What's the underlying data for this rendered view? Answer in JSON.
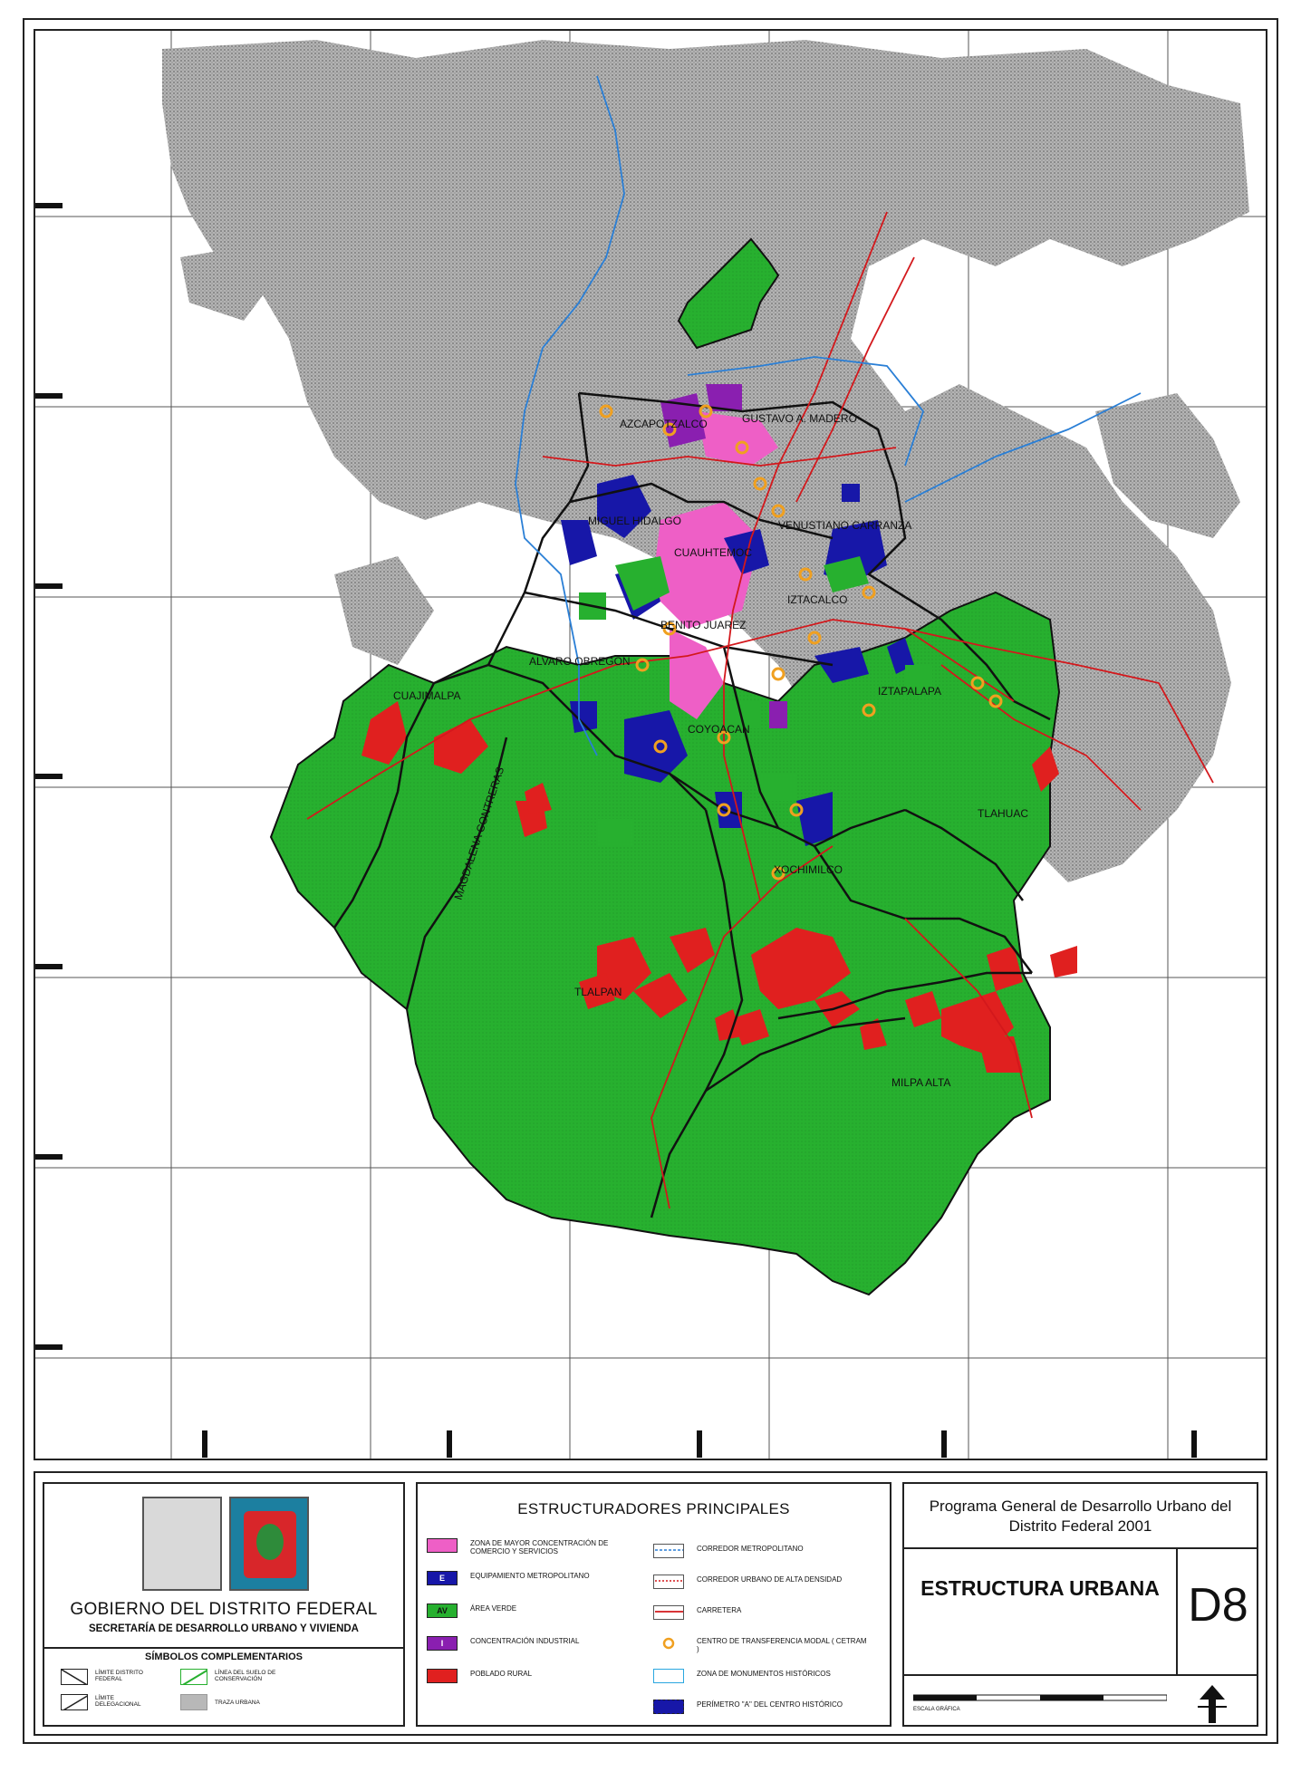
{
  "map": {
    "delegaciones": [
      "AZCAPOTZALCO",
      "GUSTAVO A. MADERO",
      "MIGUEL HIDALGO",
      "CUAUHTEMOC",
      "VENUSTIANO CARRANZA",
      "IZTACALCO",
      "BENITO JUAREZ",
      "ALVARO OBREGON",
      "CUAJIMALPA",
      "IZTAPALAPA",
      "COYOACAN",
      "MAGDALENA CONTRERAS",
      "TLAHUAC",
      "XOCHIMILCO",
      "TLALPAN",
      "MILPA ALTA"
    ],
    "swatch_code": "AV",
    "colors": {
      "conservation_green": "#27b02f",
      "urban_gray": "#9e9e9e",
      "rural_red": "#e0201f",
      "commerce_pink": "#ee5fc6",
      "equipment_blue": "#1717a8",
      "industrial_purple": "#8a1fb0",
      "road_red": "#d3181c",
      "metro_blue": "#2a7fd6",
      "cetram_orange": "#f0a020"
    }
  },
  "government": {
    "title": "GOBIERNO DEL DISTRITO FEDERAL",
    "subtitle": "SECRETARÍA DE DESARROLLO URBANO Y VIVIENDA"
  },
  "simbolos": {
    "heading": "SÍMBOLOS COMPLEMENTARIOS",
    "items": [
      {
        "label": "LÍMITE DISTRITO FEDERAL"
      },
      {
        "label": "LÍNEA DEL SUELO DE CONSERVACIÓN"
      },
      {
        "label": "LÍMITE DELEGACIONAL"
      },
      {
        "label": "TRAZA URBANA"
      }
    ]
  },
  "legend": {
    "heading": "ESTRUCTURADORES PRINCIPALES",
    "left": [
      {
        "label": "ZONA DE MAYOR CONCENTRACIÓN DE COMERCIO Y SERVICIOS",
        "color": "#ee5fc6",
        "code": ""
      },
      {
        "label": "EQUIPAMIENTO METROPOLITANO",
        "color": "#1717a8",
        "code": "E"
      },
      {
        "label": "ÁREA VERDE",
        "color": "#27b02f",
        "code": "AV"
      },
      {
        "label": "CONCENTRACIÓN INDUSTRIAL",
        "color": "#8a1fb0",
        "code": "I"
      },
      {
        "label": "POBLADO RURAL",
        "color": "#e0201f",
        "code": ""
      }
    ],
    "right": [
      {
        "label": "CORREDOR METROPOLITANO"
      },
      {
        "label": "CORREDOR URBANO DE ALTA DENSIDAD"
      },
      {
        "label": "CARRETERA"
      },
      {
        "label": "CENTRO DE TRANSFERENCIA MODAL ( CETRAM )"
      },
      {
        "label": "ZONA DE MONUMENTOS HISTÓRICOS"
      },
      {
        "label": "PERÍMETRO \"A\" DEL CENTRO HISTÓRICO"
      }
    ]
  },
  "title_block": {
    "program": "Programa General de Desarrollo Urbano del Distrito Federal 2001",
    "main_title": "ESTRUCTURA URBANA",
    "code": "D8",
    "scale_caption": "ESCALA GRÁFICA"
  }
}
